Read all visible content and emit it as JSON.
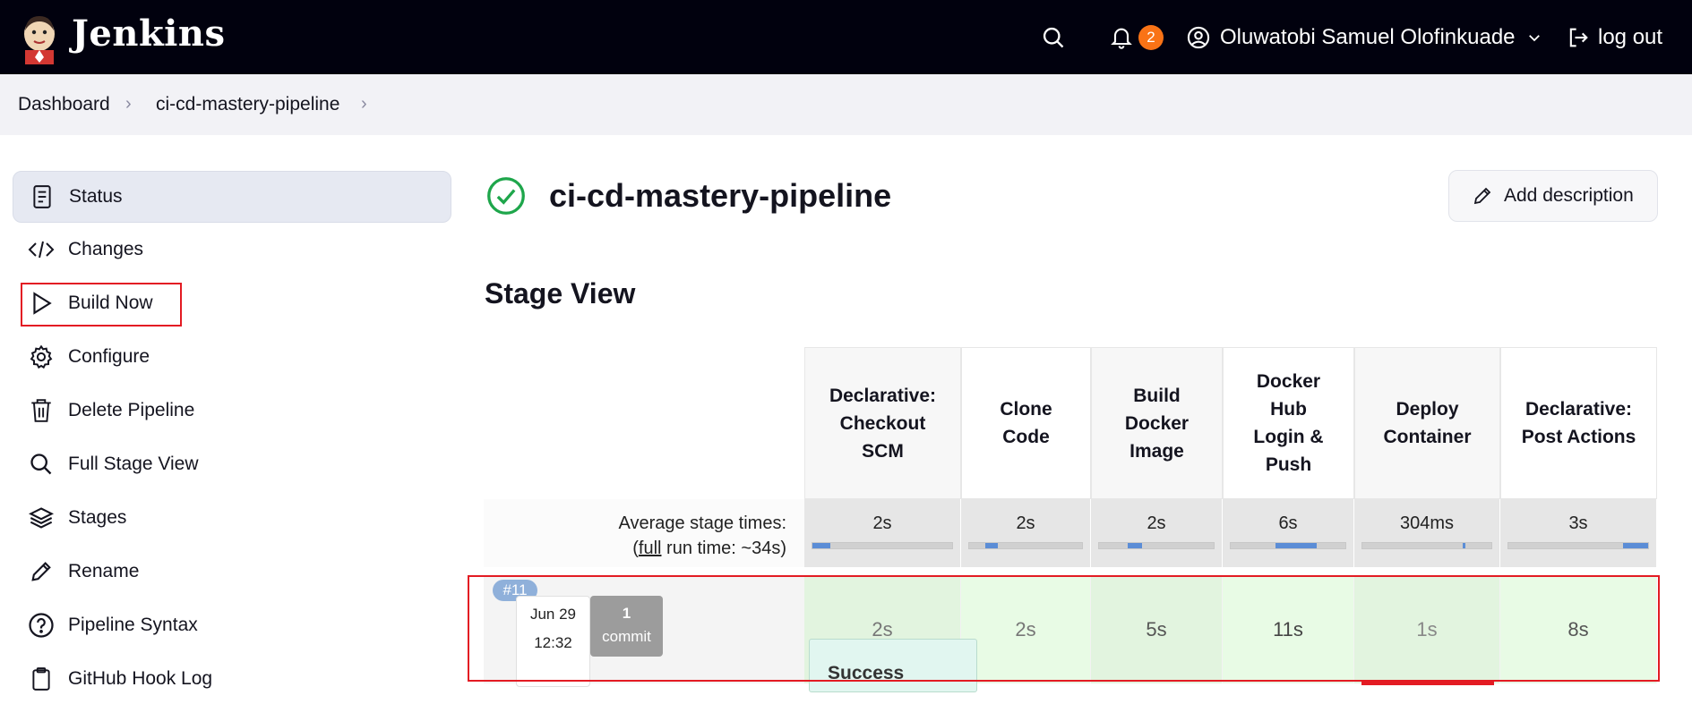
{
  "header": {
    "brand": "Jenkins",
    "notification_count": "2",
    "user_name": "Oluwatobi Samuel Olofinkuade",
    "logout_label": "log out",
    "icons": [
      "search-icon",
      "bell-icon",
      "user-circle-icon",
      "chevron-down-icon",
      "logout-icon"
    ]
  },
  "breadcrumb": {
    "items": [
      "Dashboard",
      "ci-cd-mastery-pipeline"
    ]
  },
  "sidebar": {
    "items": [
      {
        "label": "Status",
        "icon": "document-icon",
        "active": true
      },
      {
        "label": "Changes",
        "icon": "code-icon"
      },
      {
        "label": "Build Now",
        "icon": "play-icon",
        "highlighted": true
      },
      {
        "label": "Configure",
        "icon": "gear-icon"
      },
      {
        "label": "Delete Pipeline",
        "icon": "trash-icon"
      },
      {
        "label": "Full Stage View",
        "icon": "search-icon"
      },
      {
        "label": "Stages",
        "icon": "layers-icon"
      },
      {
        "label": "Rename",
        "icon": "pencil-icon"
      },
      {
        "label": "Pipeline Syntax",
        "icon": "question-circle-icon"
      },
      {
        "label": "GitHub Hook Log",
        "icon": "clipboard-icon"
      }
    ]
  },
  "main": {
    "title": "ci-cd-mastery-pipeline",
    "status_icon": "success-check-icon",
    "add_description_label": "Add description",
    "stage_view_title": "Stage View"
  },
  "stage_view": {
    "columns": [
      {
        "label": "Declarative: Checkout SCM",
        "avg": "2s"
      },
      {
        "label": "Clone Code",
        "avg": "2s"
      },
      {
        "label": "Build Docker Image",
        "avg": "2s"
      },
      {
        "label": "Docker Hub Login & Push",
        "avg": "6s"
      },
      {
        "label": "Deploy Container",
        "avg": "304ms"
      },
      {
        "label": "Declarative: Post Actions",
        "avg": "3s"
      }
    ],
    "avg_label_line1": "Average stage times:",
    "avg_label_full": "full",
    "avg_label_rest": " run time: ~34s)",
    "avg_label_open": "(",
    "build": {
      "number": "#11",
      "date": "Jun 29",
      "time": "12:32",
      "commit_count": "1",
      "commit_word": "commit",
      "cells": [
        "2s",
        "2s",
        "5s",
        "11s",
        "1s",
        "8s"
      ]
    },
    "tooltip": "Success"
  },
  "colors": {
    "header_bg": "#01010e",
    "badge": "#f97316",
    "success_green": "#1ea64b",
    "stage_success_bg": "#e2f4df",
    "highlight_red": "#e31b23",
    "progress_blue": "#5b8dd6"
  }
}
